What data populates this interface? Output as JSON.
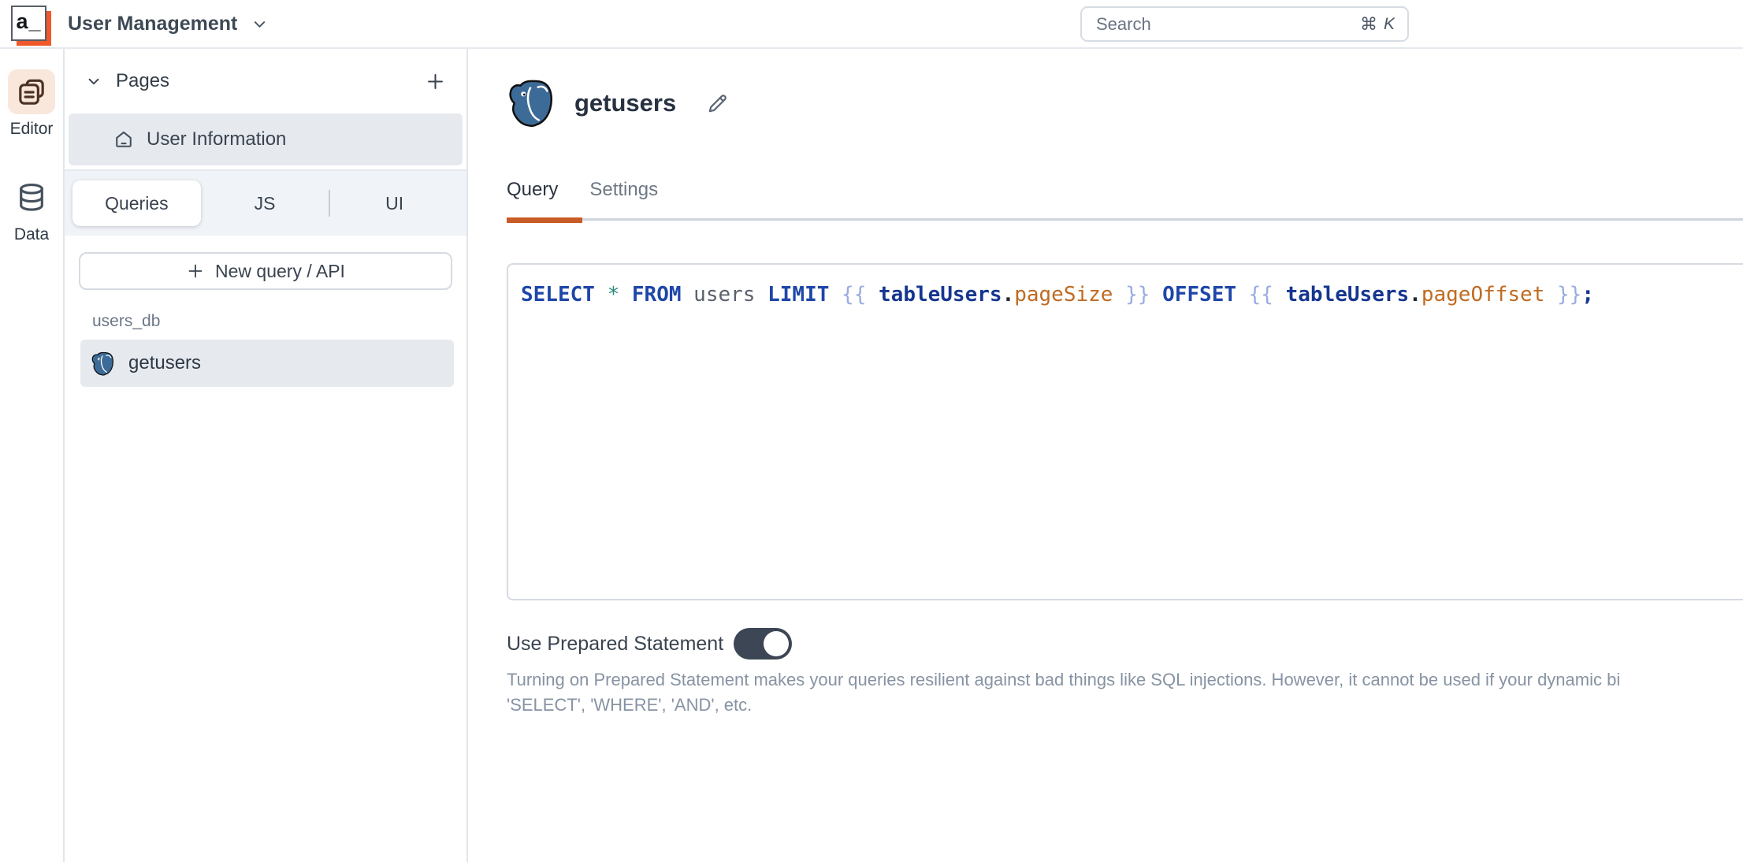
{
  "topbar": {
    "logo_text": "a_",
    "app_title": "User Management",
    "search_placeholder": "Search",
    "search_shortcut_cmd": "⌘",
    "search_shortcut_key": "K"
  },
  "rail": {
    "items": [
      {
        "label": "Editor",
        "icon": "pages-stack-icon",
        "active": true
      },
      {
        "label": "Data",
        "icon": "database-icon",
        "active": false
      }
    ]
  },
  "pages": {
    "header": "Pages",
    "page_items": [
      {
        "label": "User Information",
        "icon": "home-icon",
        "selected": true
      }
    ],
    "tabs": [
      {
        "label": "Queries",
        "active": true
      },
      {
        "label": "JS",
        "active": false
      },
      {
        "label": "UI",
        "active": false
      }
    ],
    "new_query_label": "New query / API",
    "group_label": "users_db",
    "query_items": [
      {
        "label": "getusers",
        "icon": "postgres-icon",
        "selected": true
      }
    ]
  },
  "main": {
    "query_name": "getusers",
    "tabs": [
      {
        "label": "Query",
        "active": true
      },
      {
        "label": "Settings",
        "active": false
      }
    ],
    "sql_plain": "SELECT * FROM users LIMIT {{ tableUsers.pageSize }} OFFSET {{ tableUsers.pageOffset }};",
    "code_tokens": [
      {
        "text": "SELECT",
        "type": "kw"
      },
      {
        "text": " ",
        "type": "sp"
      },
      {
        "text": "*",
        "type": "star"
      },
      {
        "text": " ",
        "type": "sp"
      },
      {
        "text": "FROM",
        "type": "kw"
      },
      {
        "text": " ",
        "type": "sp"
      },
      {
        "text": "users",
        "type": "ident"
      },
      {
        "text": " ",
        "type": "sp"
      },
      {
        "text": "LIMIT",
        "type": "kw"
      },
      {
        "text": " ",
        "type": "sp"
      },
      {
        "text": "{{",
        "type": "brace"
      },
      {
        "text": " ",
        "type": "sp"
      },
      {
        "text": "tableUsers",
        "type": "obj"
      },
      {
        "text": ".",
        "type": "dot"
      },
      {
        "text": "pageSize",
        "type": "prop"
      },
      {
        "text": " ",
        "type": "sp"
      },
      {
        "text": "}}",
        "type": "brace"
      },
      {
        "text": " ",
        "type": "sp"
      },
      {
        "text": "OFFSET",
        "type": "kw"
      },
      {
        "text": " ",
        "type": "sp"
      },
      {
        "text": "{{",
        "type": "brace"
      },
      {
        "text": " ",
        "type": "sp"
      },
      {
        "text": "tableUsers",
        "type": "obj"
      },
      {
        "text": ".",
        "type": "dot"
      },
      {
        "text": "pageOffset",
        "type": "prop"
      },
      {
        "text": " ",
        "type": "sp"
      },
      {
        "text": "}}",
        "type": "brace"
      },
      {
        "text": ";",
        "type": "semi"
      }
    ],
    "prepared": {
      "label": "Use Prepared Statement",
      "enabled": true,
      "desc_line1": "Turning on Prepared Statement makes your queries resilient against bad things like SQL injections. However, it cannot be used if your dynamic bi",
      "desc_line2": "'SELECT', 'WHERE', 'AND', etc."
    }
  },
  "colors": {
    "accent_orange": "#C95B27",
    "logo_orange": "#F0582B",
    "selected_row": "#E6EAEF",
    "rail_active_bg": "#FAE7DB",
    "toggle_on": "#3C4654",
    "postgres_blue": "#3D6B97",
    "border_light": "#E2E6EB"
  }
}
